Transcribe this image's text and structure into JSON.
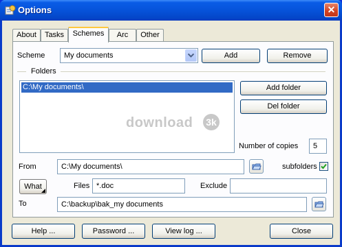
{
  "window": {
    "title": "Options",
    "close_glyph": "✕"
  },
  "tabs": [
    {
      "label": "About",
      "active": false
    },
    {
      "label": "Tasks",
      "active": false
    },
    {
      "label": "Schemes",
      "active": true
    },
    {
      "label": "Arc",
      "active": false
    },
    {
      "label": "Other",
      "active": false
    }
  ],
  "scheme": {
    "label": "Scheme",
    "value": "My documents",
    "add_label": "Add",
    "remove_label": "Remove"
  },
  "folders": {
    "group_label": "Folders",
    "items": [
      "C:\\My documents\\"
    ],
    "add_folder_label": "Add folder",
    "del_folder_label": "Del folder",
    "copies_label": "Number of copies",
    "copies_value": "5"
  },
  "watermark": {
    "text": "download",
    "badge": "3k"
  },
  "from": {
    "label": "From",
    "value": "C:\\My documents\\"
  },
  "subfolders": {
    "label": "subfolders",
    "checked": true
  },
  "what": {
    "label": "What"
  },
  "files": {
    "label": "Files",
    "value": "*.doc"
  },
  "exclude": {
    "label": "Exclude",
    "value": ""
  },
  "to": {
    "label": "To",
    "value": "C:\\backup\\bak_my documents"
  },
  "footer": {
    "help_label": "Help ...",
    "password_label": "Password ...",
    "viewlog_label": "View log ...",
    "close_label": "Close"
  },
  "colors": {
    "title_bar": "#0653da",
    "selection": "#316ac5",
    "face": "#ece9d8"
  }
}
